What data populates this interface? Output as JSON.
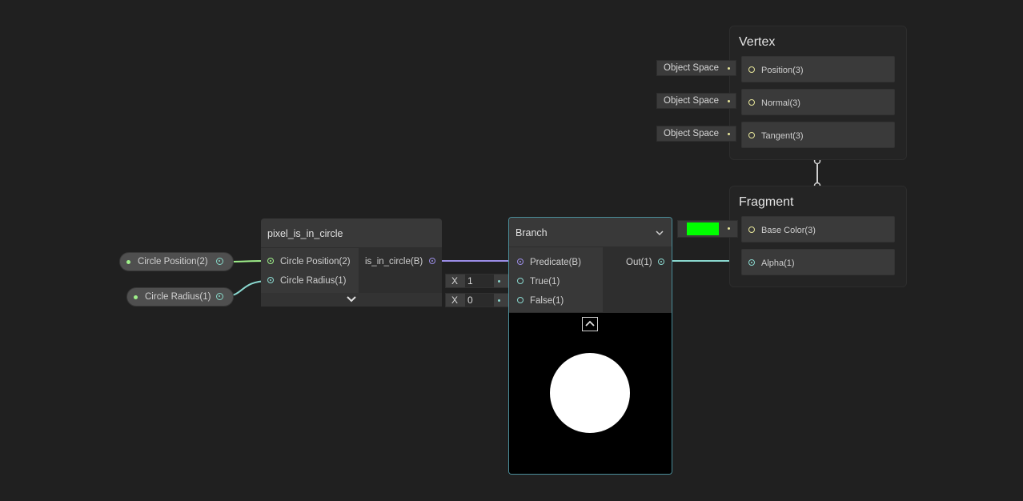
{
  "properties": {
    "circle_position": "Circle Position(2)",
    "circle_radius": "Circle Radius(1)"
  },
  "subgraph_node": {
    "title": "pixel_is_in_circle",
    "inputs": [
      "Circle Position(2)",
      "Circle Radius(1)"
    ],
    "output": "is_in_circle(B)"
  },
  "branch_node": {
    "title": "Branch",
    "inputs": [
      "Predicate(B)",
      "True(1)",
      "False(1)"
    ],
    "output": "Out(1)",
    "true_field": {
      "axis": "X",
      "value": "1"
    },
    "false_field": {
      "axis": "X",
      "value": "0"
    }
  },
  "vertex": {
    "title": "Vertex",
    "blocks": [
      {
        "space": "Object Space",
        "label": "Position(3)"
      },
      {
        "space": "Object Space",
        "label": "Normal(3)"
      },
      {
        "space": "Object Space",
        "label": "Tangent(3)"
      }
    ]
  },
  "fragment": {
    "title": "Fragment",
    "blocks": [
      {
        "label": "Base Color(3)"
      },
      {
        "label": "Alpha(1)"
      }
    ],
    "base_color_value": "#00ff00"
  },
  "colors": {
    "wire_float": "#8ad8cf",
    "wire_bool": "#9b8de6",
    "wire_vec2": "#9ff08a",
    "wire_vec3": "#e7e69a"
  },
  "icons": [
    "chevron-down-icon",
    "chevron-up-icon"
  ]
}
